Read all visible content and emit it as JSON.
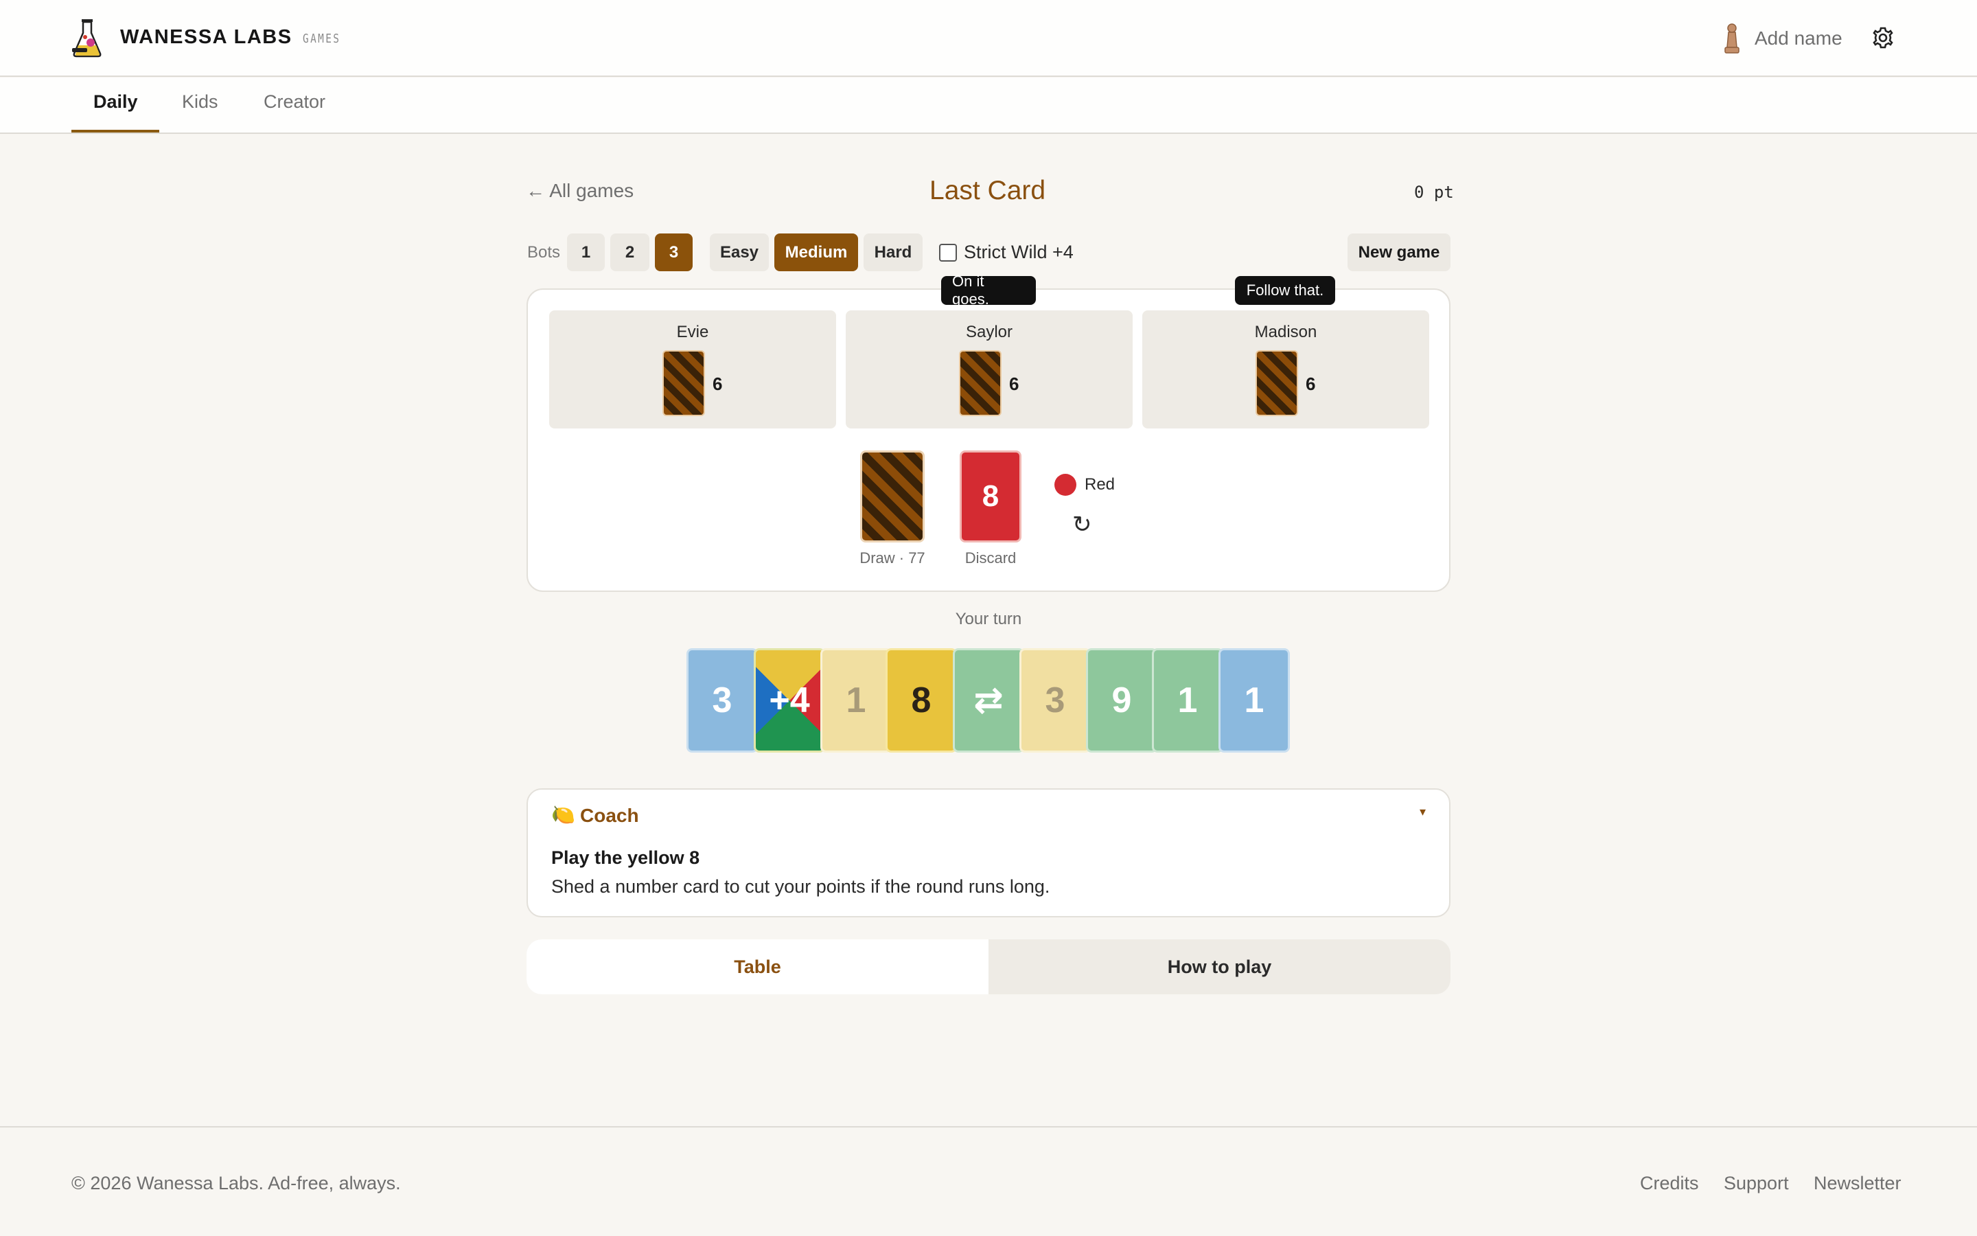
{
  "header": {
    "brand": "WANESSA LABS",
    "brand_sub": "GAMES",
    "user_label": "Add name",
    "logo_icon": "flask-icon",
    "user_icon": "pawn-icon",
    "settings_icon": "gear-icon"
  },
  "nav": {
    "tabs": [
      "Daily",
      "Kids",
      "Creator"
    ],
    "active": "Daily"
  },
  "game": {
    "back_label": "← All games",
    "title": "Last Card",
    "points": "0 pt"
  },
  "controls": {
    "bots_label": "Bots",
    "bot_options": [
      "1",
      "2",
      "3"
    ],
    "bots_selected": "3",
    "difficulty": [
      "Easy",
      "Medium",
      "Hard"
    ],
    "difficulty_selected": "Medium",
    "strict_label": "Strict Wild +4",
    "strict_checked": false,
    "new_game_label": "New game"
  },
  "bots": [
    {
      "name": "Evie",
      "count": "6",
      "bubble": ""
    },
    {
      "name": "Saylor",
      "count": "6",
      "bubble": "On it goes."
    },
    {
      "name": "Madison",
      "count": "6",
      "bubble": "Follow that."
    }
  ],
  "table": {
    "draw_label": "Draw · 77",
    "discard_value": "8",
    "discard_label": "Discard",
    "current_color": "Red",
    "current_color_hex": "#d42b32",
    "direction_icon": "↻"
  },
  "turn_label": "Your turn",
  "hand": [
    {
      "value": "3",
      "color": "blue"
    },
    {
      "value": "+4",
      "color": "wild"
    },
    {
      "value": "1",
      "color": "yellow-dim"
    },
    {
      "value": "8",
      "color": "yellow"
    },
    {
      "value": "⇄",
      "color": "green"
    },
    {
      "value": "3",
      "color": "yellow-dim"
    },
    {
      "value": "9",
      "color": "green"
    },
    {
      "value": "1",
      "color": "green"
    },
    {
      "value": "1",
      "color": "blue"
    }
  ],
  "coach": {
    "icon": "🍋",
    "title": "Coach",
    "toggle": "▾",
    "headline": "Play the yellow 8",
    "text": "Shed a number card to cut your points if the round runs long."
  },
  "bottom_tabs": {
    "table": "Table",
    "how_to_play": "How to play",
    "active": "Table"
  },
  "footer": {
    "copyright": "© 2026 Wanessa Labs. Ad-free, always.",
    "links": [
      "Credits",
      "Support",
      "Newsletter"
    ]
  },
  "colors": {
    "accent": "#8b520b",
    "red": "#d42b32",
    "yellow": "#e8c33c",
    "green": "#8ec79c",
    "blue": "#8bb9de"
  }
}
